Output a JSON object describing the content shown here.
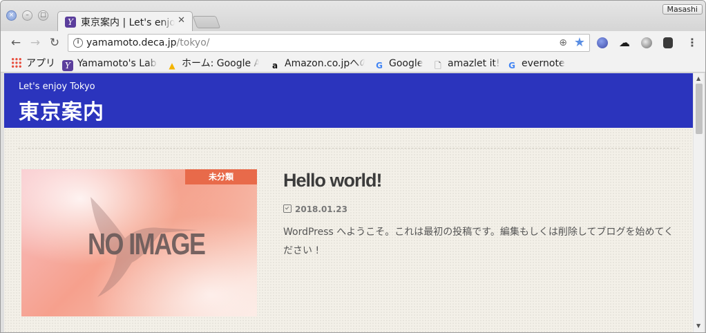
{
  "window": {
    "profile_name": "Masashi"
  },
  "tab": {
    "title": "東京案内 | Let's enjoy Tokyo",
    "favicon_glyph": "Y",
    "close_glyph": "✕"
  },
  "toolbar": {
    "back_glyph": "←",
    "forward_glyph": "→",
    "reload_glyph": "↻",
    "info_glyph": "i",
    "url_host": "yamamoto.deca.jp",
    "url_path": "/tokyo/",
    "zoom_glyph": "⊕",
    "star_glyph": "★",
    "menu_glyph": "⋮",
    "cloud_glyph": "☁"
  },
  "bookmarks": [
    {
      "icon": "apps-grid-icon",
      "label": "アプリ"
    },
    {
      "icon": "y-logo-icon",
      "glyph": "Y",
      "label": "Yamamoto's Lab"
    },
    {
      "icon": "google-drive-icon",
      "glyph": "▲",
      "label": "ホーム: Google Ana"
    },
    {
      "icon": "amazon-icon",
      "glyph": "a",
      "label": "Amazon.co.jpへの"
    },
    {
      "icon": "google-icon",
      "glyph": "G",
      "label": "Google"
    },
    {
      "icon": "document-icon",
      "glyph": "🗋",
      "label": "amazlet it!"
    },
    {
      "icon": "google-icon",
      "glyph": "G",
      "label": "evernote"
    }
  ],
  "site": {
    "tagline": "Let's enjoy Tokyo",
    "title": "東京案内"
  },
  "post": {
    "category": "未分類",
    "thumbnail_text": "NO IMAGE",
    "title": "Hello world!",
    "date": "2018.01.23",
    "excerpt": "WordPress へようこそ。これは最初の投稿です。編集もしくは削除してブログを始めてください !"
  },
  "colors": {
    "header_bg": "#2b34bd",
    "category_badge": "#e86a4a",
    "page_bg": "#f3f0e8"
  }
}
